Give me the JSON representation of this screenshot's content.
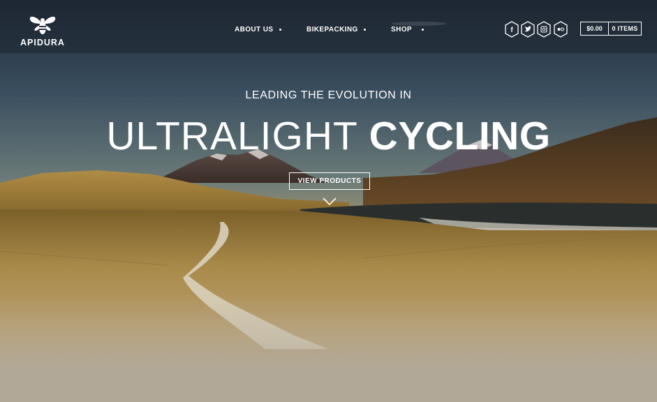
{
  "brand": {
    "name": "APIDURA"
  },
  "nav": {
    "items": [
      {
        "label": "ABOUT US"
      },
      {
        "label": "BIKEPACKING"
      },
      {
        "label": "SHOP"
      }
    ]
  },
  "social": {
    "icons": [
      "facebook-icon",
      "twitter-icon",
      "instagram-icon",
      "flickr-icon"
    ]
  },
  "cart": {
    "total": "$0.00",
    "items": "0 ITEMS"
  },
  "hero": {
    "tagline": "LEADING THE EVOLUTION IN",
    "headline_light": "ULTRALIGHT",
    "headline_bold": "CYCLING",
    "cta_label": "VIEW PRODUCTS"
  },
  "colors": {
    "sky": "#2e3d4f",
    "sand": "#a68a4a",
    "text": "#ffffff"
  }
}
